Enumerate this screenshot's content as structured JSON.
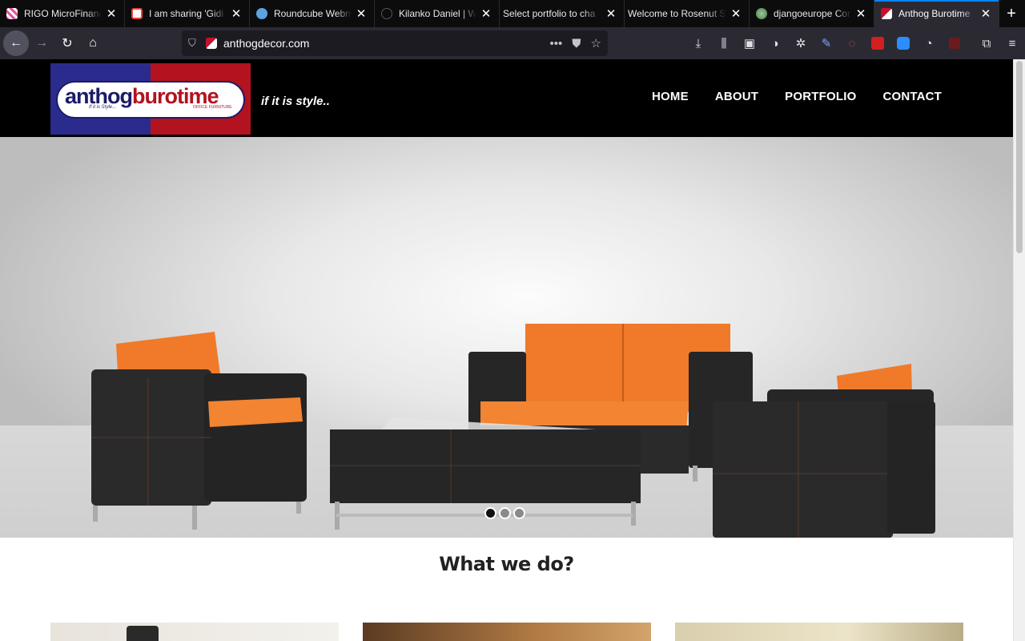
{
  "browser": {
    "tabs": [
      {
        "label": "RIGO MicroFinance",
        "favicon_color": "#e3569a",
        "active": false
      },
      {
        "label": "I am sharing 'Gidi",
        "favicon_color": "#ea4335",
        "active": false
      },
      {
        "label": "Roundcube Webmail",
        "favicon_color": "#5ba4e0",
        "active": false
      },
      {
        "label": "Kilanko Daniel | W",
        "favicon_color": "#333333",
        "active": false
      },
      {
        "label": "Select portfolio to cha",
        "favicon_color": "#0c0c0d",
        "active": false
      },
      {
        "label": "Welcome to Rosenut S",
        "favicon_color": "#0c0c0d",
        "active": false
      },
      {
        "label": "djangoeurope Con",
        "favicon_color": "#7aa37a",
        "active": false
      },
      {
        "label": "Anthog Burotime",
        "favicon_color": "#c8102e",
        "active": true
      }
    ],
    "url": "anthogdecor.com"
  },
  "site": {
    "logo": {
      "word1": "anthog",
      "word2": "burotime",
      "tag": "If it is Style...",
      "sub": "OFFICE FURNITURE"
    },
    "tagline": "if it is style..",
    "nav": [
      "HOME",
      "ABOUT",
      "PORTFOLIO",
      "CONTACT"
    ],
    "slider": {
      "slides": 3,
      "current": 1
    },
    "section_title": "What we do?"
  }
}
